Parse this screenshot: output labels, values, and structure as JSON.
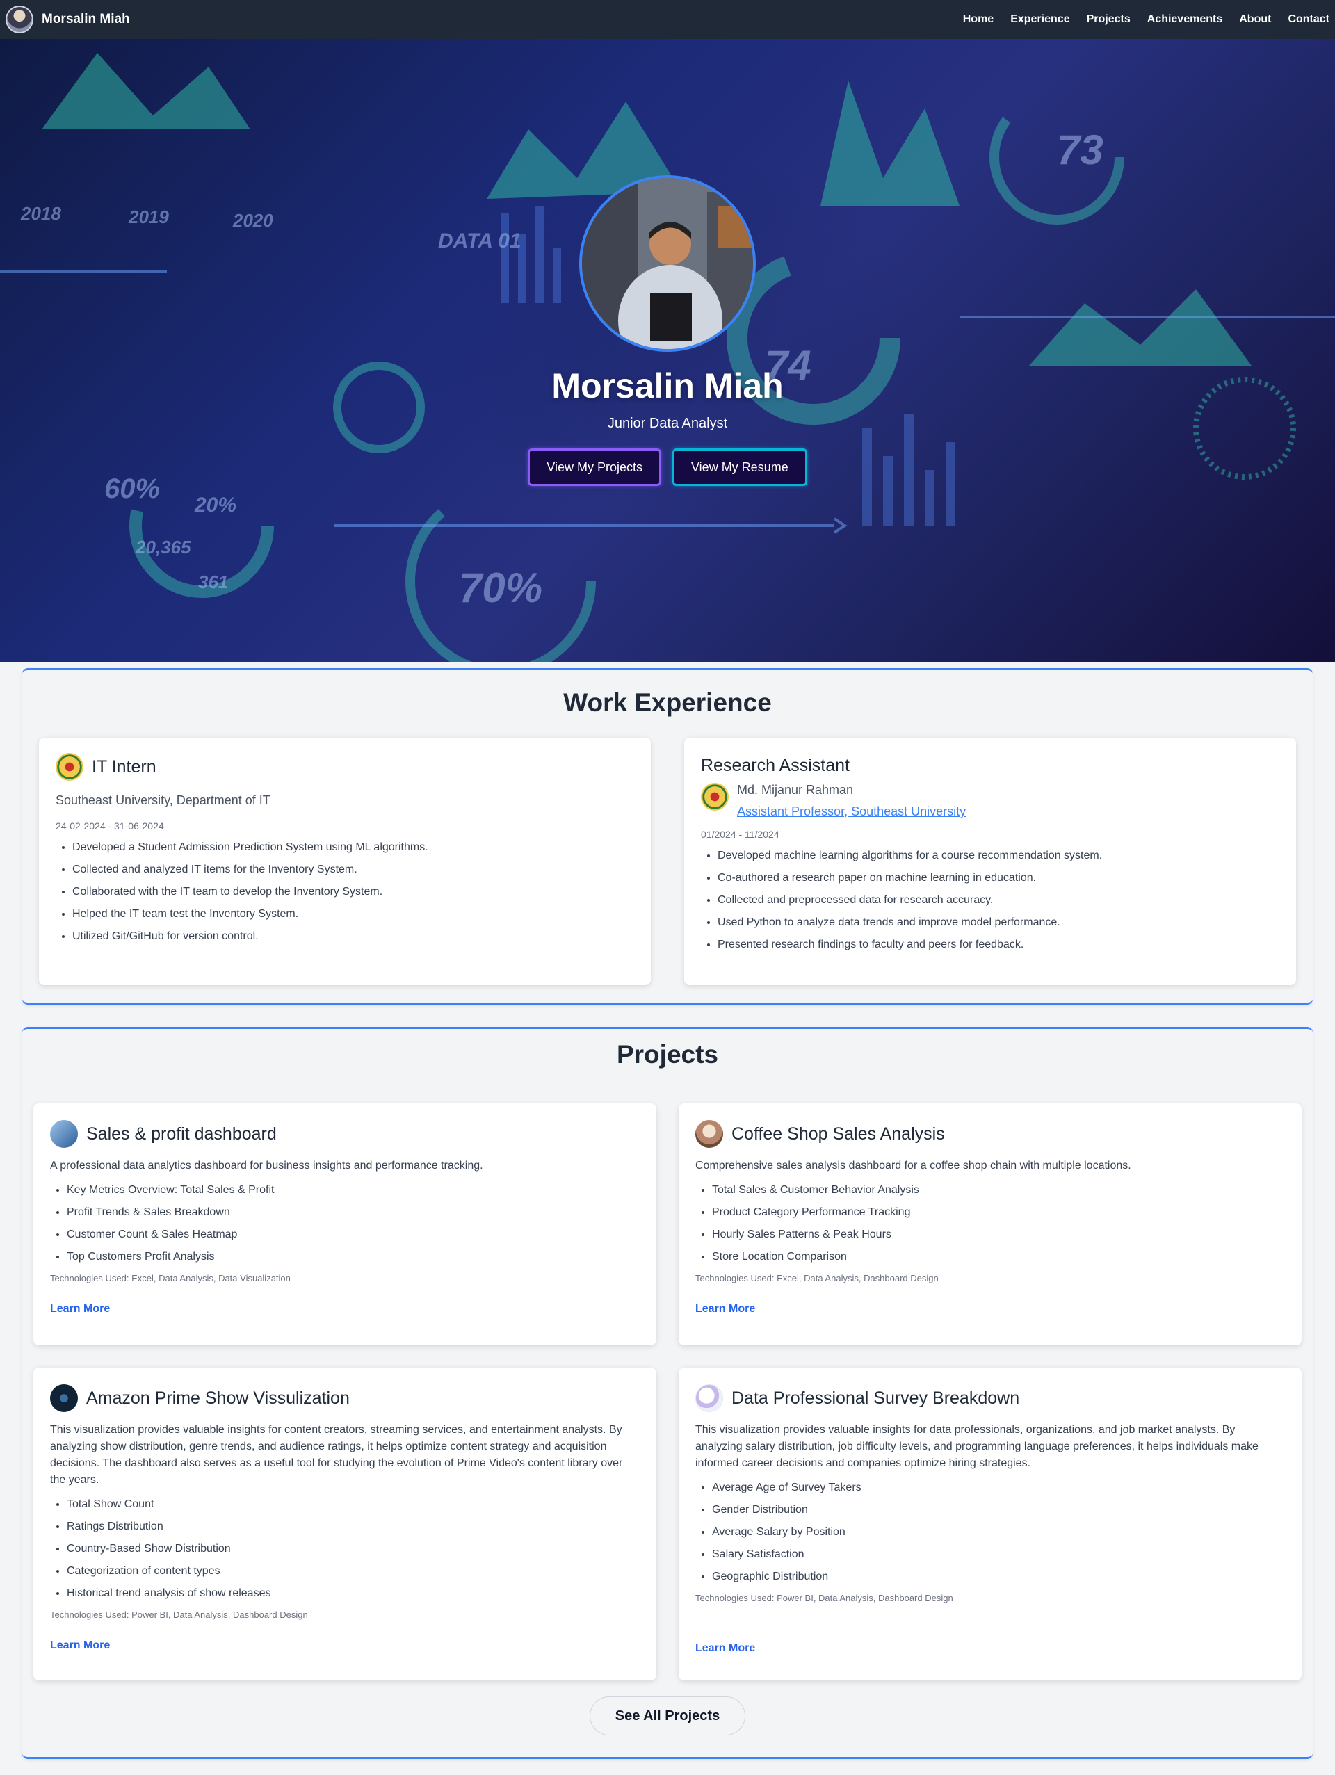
{
  "nav": {
    "brand": "Morsalin Miah",
    "links": [
      "Home",
      "Experience",
      "Projects",
      "Achievements",
      "About",
      "Contact"
    ]
  },
  "hero": {
    "name": "Morsalin Miah",
    "role": "Junior Data Analyst",
    "btn_projects": "View My Projects",
    "btn_resume": "View My Resume",
    "bg_texts": [
      "2018",
      "2019",
      "2020",
      "DATA 01",
      "73",
      "74",
      "60%",
      "20%",
      "20,365",
      "361",
      "70%"
    ]
  },
  "experience": {
    "title": "Work Experience",
    "cards": [
      {
        "title": "IT Intern",
        "org": "Southeast University, Department of IT",
        "date": "24-02-2024 - 31-06-2024",
        "bullets": [
          "Developed a Student Admission Prediction System using ML algorithms.",
          "Collected and analyzed IT items for the Inventory System.",
          "Collaborated with the IT team to develop the Inventory System.",
          "Helped the IT team test the Inventory System.",
          "Utilized Git/GitHub for version control."
        ]
      },
      {
        "title": "Research Assistant",
        "supervisor": "Md. Mijanur Rahman",
        "supervisor_role": "Assistant Professor, Southeast University",
        "date": "01/2024 - 11/2024",
        "bullets": [
          "Developed machine learning algorithms for a course recommendation system.",
          "Co-authored a research paper on machine learning in education.",
          "Collected and preprocessed data for research accuracy.",
          "Used Python to analyze data trends and improve model performance.",
          "Presented research findings to faculty and peers for feedback."
        ]
      }
    ]
  },
  "projects": {
    "title": "Projects",
    "see_all": "See All Projects",
    "learn_more": "Learn More",
    "cards": [
      {
        "title": "Sales & profit dashboard",
        "desc": "A professional data analytics dashboard for business insights and performance tracking.",
        "bullets": [
          "Key Metrics Overview: Total Sales & Profit",
          "Profit Trends & Sales Breakdown",
          "Customer Count & Sales Heatmap",
          "Top Customers Profit Analysis"
        ],
        "tech": "Technologies Used: Excel, Data Analysis, Data Visualization"
      },
      {
        "title": "Coffee Shop Sales Analysis",
        "desc": "Comprehensive sales analysis dashboard for a coffee shop chain with multiple locations.",
        "bullets": [
          "Total Sales & Customer Behavior Analysis",
          "Product Category Performance Tracking",
          "Hourly Sales Patterns & Peak Hours",
          "Store Location Comparison"
        ],
        "tech": "Technologies Used: Excel, Data Analysis, Dashboard Design"
      },
      {
        "title": "Amazon Prime Show Vissulization",
        "desc": "This visualization provides valuable insights for content creators, streaming services, and entertainment analysts. By analyzing show distribution, genre trends, and audience ratings, it helps optimize content strategy and acquisition decisions. The dashboard also serves as a useful tool for studying the evolution of Prime Video's content library over the years.",
        "bullets": [
          "Total Show Count",
          "Ratings Distribution",
          "Country-Based Show Distribution",
          "Categorization of content types",
          "Historical trend analysis of show releases"
        ],
        "tech": "Technologies Used: Power BI, Data Analysis, Dashboard Design"
      },
      {
        "title": "Data Professional Survey Breakdown",
        "desc": "This visualization provides valuable insights for data professionals, organizations, and job market analysts. By analyzing salary distribution, job difficulty levels, and programming language preferences, it helps individuals make informed career decisions and companies optimize hiring strategies.",
        "bullets": [
          "Average Age of Survey Takers",
          "Gender Distribution",
          "Average Salary by Position",
          "Salary Satisfaction",
          "Geographic Distribution"
        ],
        "tech": "Technologies Used: Power BI, Data Analysis, Dashboard Design"
      }
    ]
  }
}
